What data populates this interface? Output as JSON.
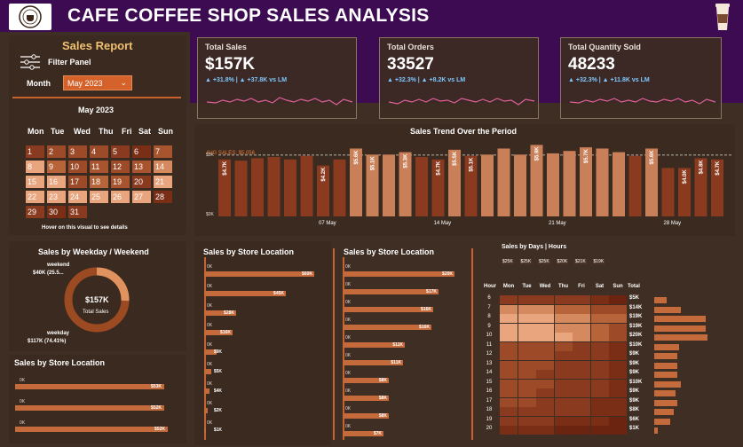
{
  "header": {
    "title": "CAFE COFFEE SHOP SALES ANALYSIS",
    "logo_text": "COFFEE SHOP"
  },
  "sidebar": {
    "report_title": "Sales Report",
    "filter_label": "Filter Panel",
    "month_label": "Month",
    "month_value": "May 2023",
    "calendar_title": "May 2023",
    "calendar_days": [
      "Mon",
      "Tue",
      "Wed",
      "Thu",
      "Fri",
      "Sat",
      "Sun"
    ],
    "calendar_weeks": [
      [
        "1",
        "2",
        "3",
        "4",
        "5",
        "6",
        "7"
      ],
      [
        "8",
        "9",
        "10",
        "11",
        "12",
        "13",
        "14"
      ],
      [
        "15",
        "16",
        "17",
        "18",
        "19",
        "20",
        "21"
      ],
      [
        "22",
        "23",
        "24",
        "25",
        "26",
        "27",
        "28"
      ],
      [
        "29",
        "30",
        "31",
        "",
        "",
        "",
        ""
      ]
    ],
    "hover_hint": "Hover on this visual to see details"
  },
  "kpis": [
    {
      "label": "Total Sales",
      "value": "$157K",
      "change": "▲ +31.8% | ▲ +37.8K vs LM"
    },
    {
      "label": "Total Orders",
      "value": "33527",
      "change": "▲ +32.3% | ▲ +8.2K vs LM"
    },
    {
      "label": "Total Quantity Sold",
      "value": "48233",
      "change": "▲ +32.3% | ▲ +11.8K vs LM"
    }
  ],
  "trend": {
    "title": "Sales Trend Over the Period",
    "avg_label": "AVG SALES: $5,056",
    "y_top": "$5K",
    "y_bottom": "$0K",
    "x_ticks": [
      "07 May",
      "14 May",
      "21 May",
      "28 May"
    ],
    "bar_labels": [
      "$4.7K",
      "$4.2K",
      "$5.6K",
      "$5.1K",
      "$5.3K",
      "$4.7K",
      "$5.5K",
      "$5.1K",
      "$5.9K",
      "$5.7K",
      "$5.6K",
      "$4.0K",
      "$4.8K",
      "$4.7K"
    ]
  },
  "weekday": {
    "title": "Sales by Weekday / Weekend",
    "center_value": "$157K",
    "center_label": "Total Sales",
    "weekend_label": "weekend",
    "weekend_value": "$40K (25.5...",
    "weekday_label": "weekday",
    "weekday_value": "$117K (74.41%)"
  },
  "store_left": {
    "title": "Sales by Store Location",
    "zero_label": "0K",
    "bar_labels": [
      "$53K",
      "$52K",
      "$52K"
    ]
  },
  "store_mid1": {
    "title": "Sales by Store Location",
    "zero_label": "0K",
    "bar_labels": [
      "$60K",
      "$45K",
      "$28K",
      "$16K",
      "$9K",
      "$5K",
      "$4K",
      "$2K",
      "$1K"
    ]
  },
  "store_mid2": {
    "title": "Sales by Store Location",
    "zero_label": "0K",
    "bar_labels": [
      "$20K",
      "$17K",
      "$16K",
      "$16K",
      "$11K",
      "$11K",
      "$8K",
      "$8K",
      "$8K",
      "$7K"
    ]
  },
  "heatmap": {
    "title": "Sales by Days | Hours",
    "day_totals": [
      "$25K",
      "$25K",
      "$25K",
      "$20K",
      "$21K",
      "$19K"
    ],
    "days": [
      "Mon",
      "Tue",
      "Wed",
      "Thu",
      "Fri",
      "Sat",
      "Sun"
    ],
    "hour_label": "Hour",
    "total_label": "Total",
    "hours": [
      "6",
      "7",
      "8",
      "9",
      "10",
      "11",
      "12",
      "13",
      "14",
      "15",
      "16",
      "17",
      "18",
      "19",
      "20"
    ],
    "hour_totals": [
      "$5K",
      "$14K",
      "$19K",
      "$19K",
      "$20K",
      "$10K",
      "$9K",
      "$9K",
      "$9K",
      "$10K",
      "$9K",
      "$9K",
      "$8K",
      "$6K",
      "$1K"
    ]
  },
  "colors": {
    "header": "#3d0b52",
    "background": "#3f2e23",
    "accent": "#c8622e",
    "bar_light": "#c98058",
    "bar_dark": "#8a3a1e",
    "calendar_light": "#e9a57e"
  }
}
